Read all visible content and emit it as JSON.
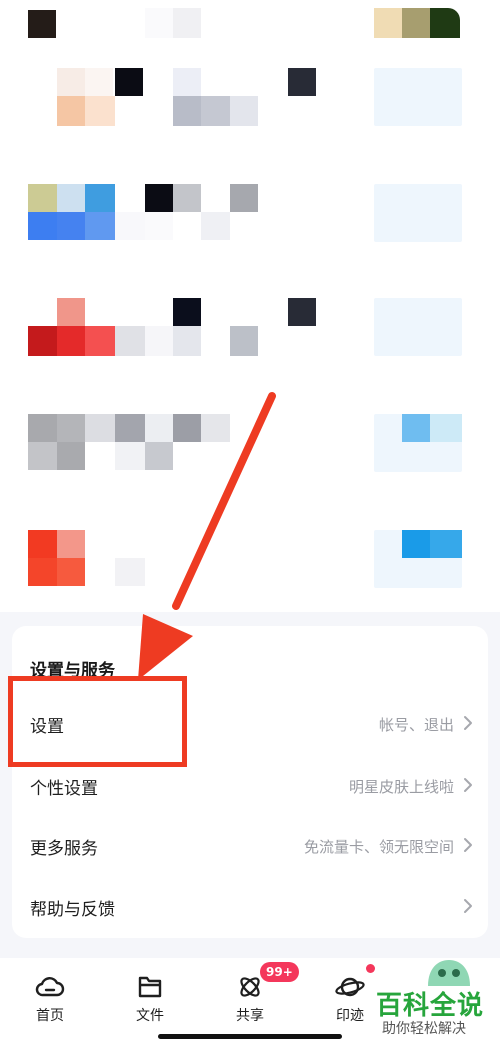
{
  "section": {
    "title": "设置与服务",
    "rows": [
      {
        "label": "设置",
        "hint": "帐号、退出"
      },
      {
        "label": "个性设置",
        "hint": "明星皮肤上线啦"
      },
      {
        "label": "更多服务",
        "hint": "免流量卡、领无限空间"
      },
      {
        "label": "帮助与反馈",
        "hint": ""
      }
    ]
  },
  "tabbar": {
    "tabs": [
      {
        "label": "首页",
        "icon": "cloud-icon"
      },
      {
        "label": "文件",
        "icon": "folder-icon"
      },
      {
        "label": "共享",
        "icon": "atom-icon"
      },
      {
        "label": "印迹",
        "icon": "planet-icon"
      }
    ],
    "share_badge": "99+"
  },
  "watermark": {
    "title": "百科全说",
    "subtitle": "助你轻松解决"
  },
  "colors": {
    "annotation": "#ee3b22",
    "badge": "#f4375b",
    "watermark": "#27a53c"
  }
}
